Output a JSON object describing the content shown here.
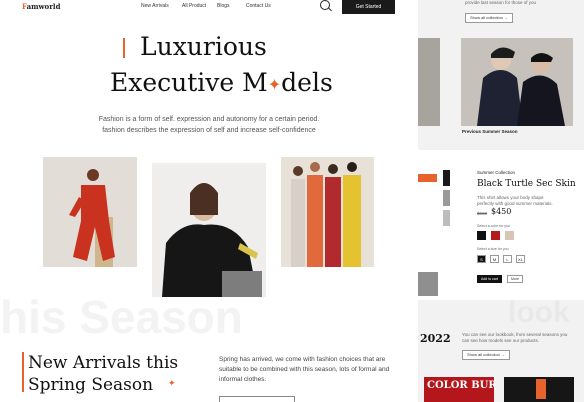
{
  "nav": {
    "logo_initial": "F",
    "logo_rest": "amworld",
    "links": [
      "New Arrivals",
      "All Product",
      "Blogs",
      "Contact Us"
    ],
    "cta_label": "Get Started"
  },
  "hero": {
    "line1": "Luxurious",
    "line2_a": "Executive M",
    "line2_b": "dels",
    "subtitle": "Fashion is a form of self. expression and autonomy for a certain period. fashion describes the expression of self and increase self-confidence"
  },
  "watermark": "his Season",
  "new_arrivals": {
    "title_line1": "New Arrivals this",
    "title_line2": "Spring Season",
    "text": "Spring has arrived, we come with fashion choices that are suitable to be combined with this season, lots of formal and informal clothes."
  },
  "side": {
    "top_text": "provide last season for those of you",
    "show_all_label": "Show all collection",
    "prev_label": "Previous Summer Season",
    "collection_label": "Summer Collection",
    "product_title": "Black Turtle Sec Skin",
    "product_desc": "This shirt allows your body shape perfectly with good summer materials.",
    "old_price": "$530",
    "price": "$450",
    "color_label": "Select a color for you",
    "size_label": "Select a size for you",
    "sizes": [
      "S",
      "M",
      "L",
      "XL"
    ],
    "btn_cart": "Add to cart",
    "btn_more": "More",
    "year": "2022",
    "year_text": "You can see our lookbook, from several seasons you can see how models see our products.",
    "show_all_label2": "Show all collection",
    "magazine_text": "COLOR BURN",
    "watermark_right": "look"
  },
  "colors": {
    "accent": "#e8622b",
    "dark": "#1a1a1a"
  }
}
